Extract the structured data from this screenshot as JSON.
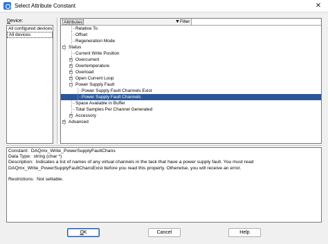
{
  "window": {
    "title": "Select Attribute Constant",
    "close_glyph": "✕",
    "icon": "app-icon"
  },
  "device_panel": {
    "label_prefix": "D",
    "label_rest": "evice:",
    "items": [
      "All configured devices",
      "All devices"
    ],
    "selected_index": 1
  },
  "attributes_panel": {
    "header_label": "Attributes",
    "filter_icon": "filter-funnel-icon",
    "filter_label": "Filter",
    "filter_value": "",
    "tree": [
      {
        "label": "Relative To",
        "level": 2,
        "type": "leaf"
      },
      {
        "label": "Offset",
        "level": 2,
        "type": "leaf"
      },
      {
        "label": "Regeneration Mode",
        "level": 2,
        "type": "leaf"
      },
      {
        "label": "Status",
        "level": 1,
        "type": "expanded"
      },
      {
        "label": "Current Write Position",
        "level": 2,
        "type": "leaf"
      },
      {
        "label": "Overcurrent",
        "level": 2,
        "type": "collapsed"
      },
      {
        "label": "Overtemperature",
        "level": 2,
        "type": "collapsed"
      },
      {
        "label": "Overload",
        "level": 2,
        "type": "collapsed"
      },
      {
        "label": "Open Current Loop",
        "level": 2,
        "type": "collapsed"
      },
      {
        "label": "Power Supply Fault",
        "level": 2,
        "type": "expanded"
      },
      {
        "label": "Power Supply Fault Channels Exist",
        "level": 3,
        "type": "leaf"
      },
      {
        "label": "Power Supply Fault Channels",
        "level": 3,
        "type": "leaf",
        "selected": true
      },
      {
        "label": "Space Available in Buffer",
        "level": 2,
        "type": "leaf"
      },
      {
        "label": "Total Samples Per Channel Generated",
        "level": 2,
        "type": "leaf"
      },
      {
        "label": "Accessory",
        "level": 2,
        "type": "collapsed"
      },
      {
        "label": "Advanced",
        "level": 1,
        "type": "collapsed"
      }
    ]
  },
  "description": {
    "lines": [
      "Constant:  DAQmx_Write_PowerSupplyFaultChans",
      "Data Type:  string (char *)",
      "Description:  Indicates a list of names of any virtual channels in the task that have a power supply fault. You must read",
      "DAQmx_Write_PowerSupplyFaultChansExist before you read this property. Otherwise, you will receive an error.",
      "",
      "Restrictions:  Not settable."
    ]
  },
  "buttons": {
    "ok_prefix": "O",
    "ok_rest": "K",
    "cancel": "Cancel",
    "help": "Help"
  }
}
